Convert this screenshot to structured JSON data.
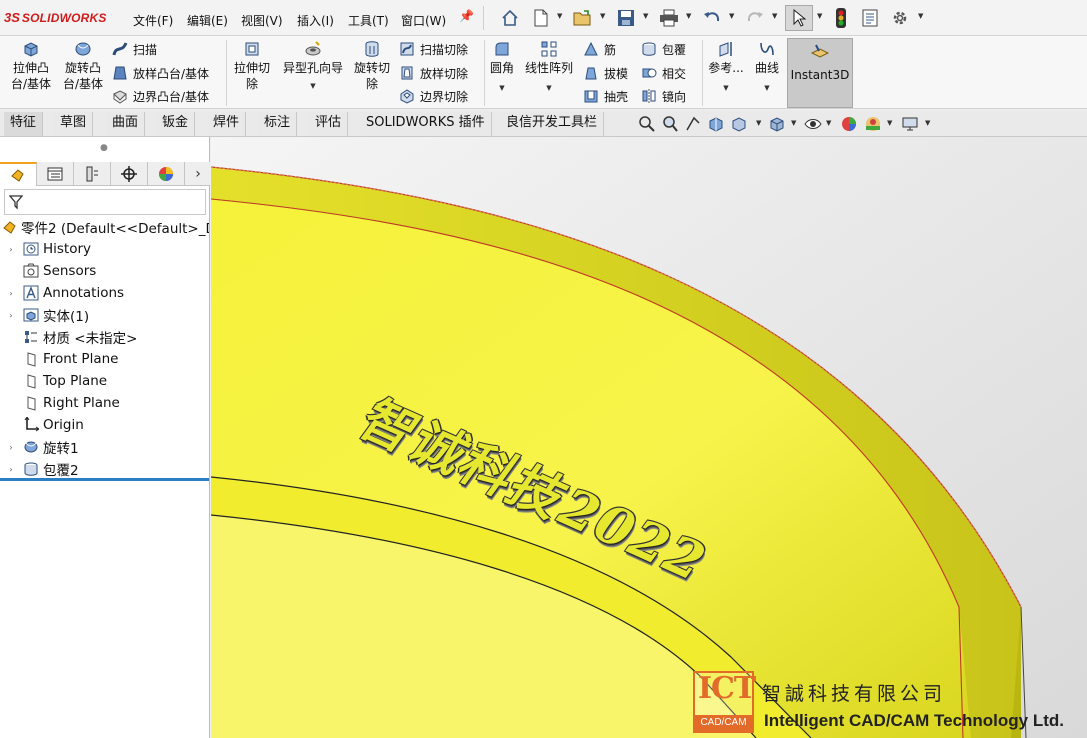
{
  "app": {
    "logo_ds": "3S",
    "logo_name": "SOLIDWORKS"
  },
  "menu": {
    "items": [
      "文件(F)",
      "编辑(E)",
      "视图(V)",
      "插入(I)",
      "工具(T)",
      "窗口(W)"
    ]
  },
  "ribbon": {
    "extrude_boss": "拉伸凸\n台/基体",
    "revolve_boss": "旋转凸\n台/基体",
    "sweep": "扫描",
    "loft_boss": "放样凸台/基体",
    "boundary_boss": "边界凸台/基体",
    "extrude_cut": "拉伸切\n除",
    "hole_wizard": "异型孔向导",
    "revolve_cut": "旋转切\n除",
    "sweep_cut": "扫描切除",
    "loft_cut": "放样切除",
    "boundary_cut": "边界切除",
    "fillet": "圆角",
    "linear_pattern": "线性阵列",
    "rib": "筋",
    "wrap": "包覆",
    "draft": "拔模",
    "intersect": "相交",
    "shell": "抽壳",
    "mirror": "镜向",
    "reference": "参考...",
    "curves": "曲线",
    "instant3d": "Instant3D"
  },
  "tabs": [
    "特征",
    "草图",
    "曲面",
    "钣金",
    "焊件",
    "标注",
    "评估",
    "SOLIDWORKS 插件",
    "良信开发工具栏"
  ],
  "active_tab": "特征",
  "tree": {
    "root": "零件2  (Default<<Default>_D",
    "items": [
      {
        "label": "History",
        "expandable": true,
        "icon": "history-icon"
      },
      {
        "label": "Sensors",
        "expandable": false,
        "icon": "sensors-icon"
      },
      {
        "label": "Annotations",
        "expandable": true,
        "icon": "annotations-icon"
      },
      {
        "label": "实体(1)",
        "expandable": true,
        "icon": "solid-bodies-icon"
      },
      {
        "label": "材质 <未指定>",
        "expandable": false,
        "icon": "material-icon"
      },
      {
        "label": "Front Plane",
        "expandable": false,
        "icon": "plane-icon"
      },
      {
        "label": "Top Plane",
        "expandable": false,
        "icon": "plane-icon"
      },
      {
        "label": "Right Plane",
        "expandable": false,
        "icon": "plane-icon"
      },
      {
        "label": "Origin",
        "expandable": false,
        "icon": "origin-icon"
      },
      {
        "label": "旋转1",
        "expandable": true,
        "icon": "revolve-feature-icon"
      },
      {
        "label": "包覆2",
        "expandable": true,
        "icon": "wrap-feature-icon"
      }
    ]
  },
  "viewport": {
    "engraving_text": "智诚科技2022",
    "part_color": "#f2f028"
  },
  "watermark": {
    "ict": "ICT",
    "band": "CAD/CAM",
    "cn": "智誠科技有限公司",
    "en": "Intelligent CAD/CAM Technology Ltd."
  },
  "colors": {
    "accent": "#f0a21e",
    "brand_red": "#d01c1c",
    "watermark_orange": "#e26b2a"
  }
}
